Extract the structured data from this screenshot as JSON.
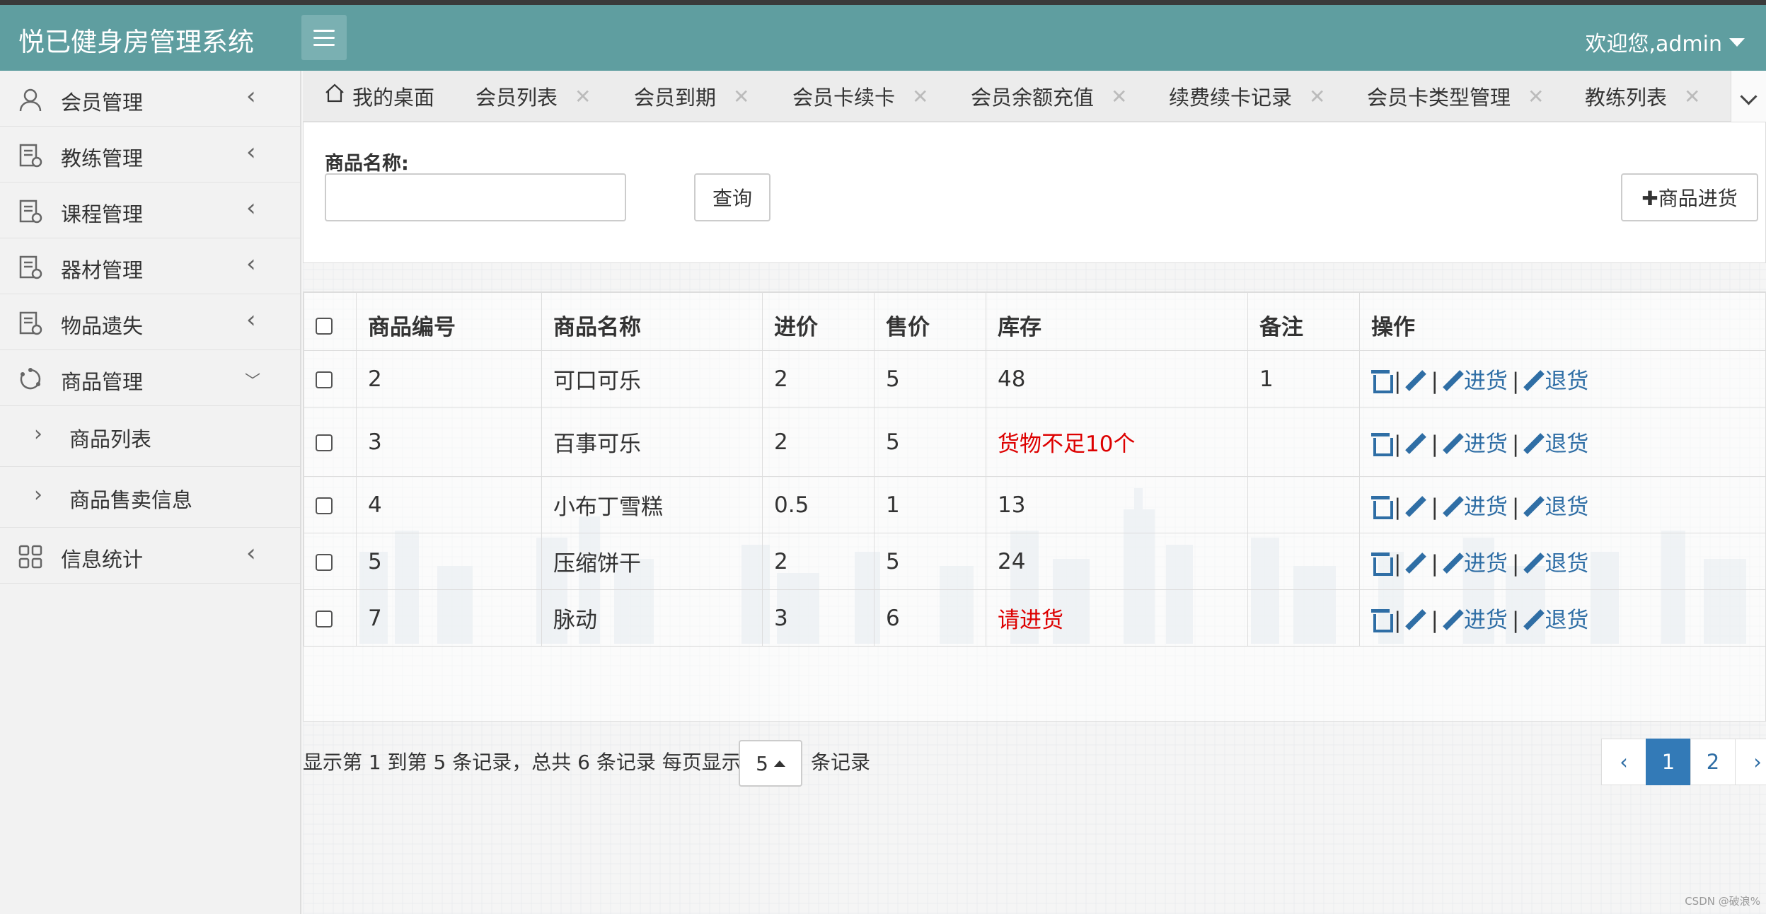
{
  "header": {
    "brand": "悦已健身房管理系统",
    "welcome": "欢迎您,admin"
  },
  "sidebar": {
    "items": [
      {
        "label": "会员管理",
        "icon": "user-icon",
        "expanded": false
      },
      {
        "label": "教练管理",
        "icon": "document-icon",
        "expanded": false
      },
      {
        "label": "课程管理",
        "icon": "document-icon",
        "expanded": false
      },
      {
        "label": "器材管理",
        "icon": "document-icon",
        "expanded": false
      },
      {
        "label": "物品遗失",
        "icon": "document-icon",
        "expanded": false
      },
      {
        "label": "商品管理",
        "icon": "refresh-icon",
        "expanded": true
      },
      {
        "label": "信息统计",
        "icon": "grid-icon",
        "expanded": false
      }
    ],
    "sub_items": [
      {
        "label": "商品列表"
      },
      {
        "label": "商品售卖信息"
      }
    ]
  },
  "tabs": [
    {
      "label": "我的桌面",
      "home": true
    },
    {
      "label": "会员列表"
    },
    {
      "label": "会员到期"
    },
    {
      "label": "会员卡续卡"
    },
    {
      "label": "会员余额充值"
    },
    {
      "label": "续费续卡记录"
    },
    {
      "label": "会员卡类型管理"
    },
    {
      "label": "教练列表"
    }
  ],
  "search": {
    "label": "商品名称:",
    "value": "",
    "button": "查询",
    "stock_button": "✚商品进货"
  },
  "table": {
    "columns": [
      "商品编号",
      "商品名称",
      "进价",
      "售价",
      "库存",
      "备注",
      "操作"
    ],
    "rows": [
      {
        "id": "2",
        "name": "可口可乐",
        "cost": "2",
        "price": "5",
        "stock": "48",
        "stock_warning": false,
        "note": "1"
      },
      {
        "id": "3",
        "name": "百事可乐",
        "cost": "2",
        "price": "5",
        "stock": "货物不足10个",
        "stock_warning": true,
        "note": ""
      },
      {
        "id": "4",
        "name": "小布丁雪糕",
        "cost": "0.5",
        "price": "1",
        "stock": "13",
        "stock_warning": false,
        "note": ""
      },
      {
        "id": "5",
        "name": "压缩饼干",
        "cost": "2",
        "price": "5",
        "stock": "24",
        "stock_warning": false,
        "note": ""
      },
      {
        "id": "7",
        "name": "脉动",
        "cost": "3",
        "price": "6",
        "stock": "请进货",
        "stock_warning": true,
        "note": ""
      }
    ],
    "ops": {
      "restock": "进货",
      "return": "退货",
      "sep": "|"
    }
  },
  "pager": {
    "text_before": "显示第 1 到第 5 条记录，总共 6 条记录 每页显示",
    "page_size": "5",
    "text_after": "条记录",
    "prev": "‹",
    "pages": [
      "1",
      "2"
    ],
    "next": "›",
    "current": "1"
  },
  "credit": "CSDN @破浪%",
  "colors": {
    "header": "#5f9ea0",
    "link": "#2f6ea5",
    "warning": "#d00000",
    "active_page": "#337ab7"
  }
}
